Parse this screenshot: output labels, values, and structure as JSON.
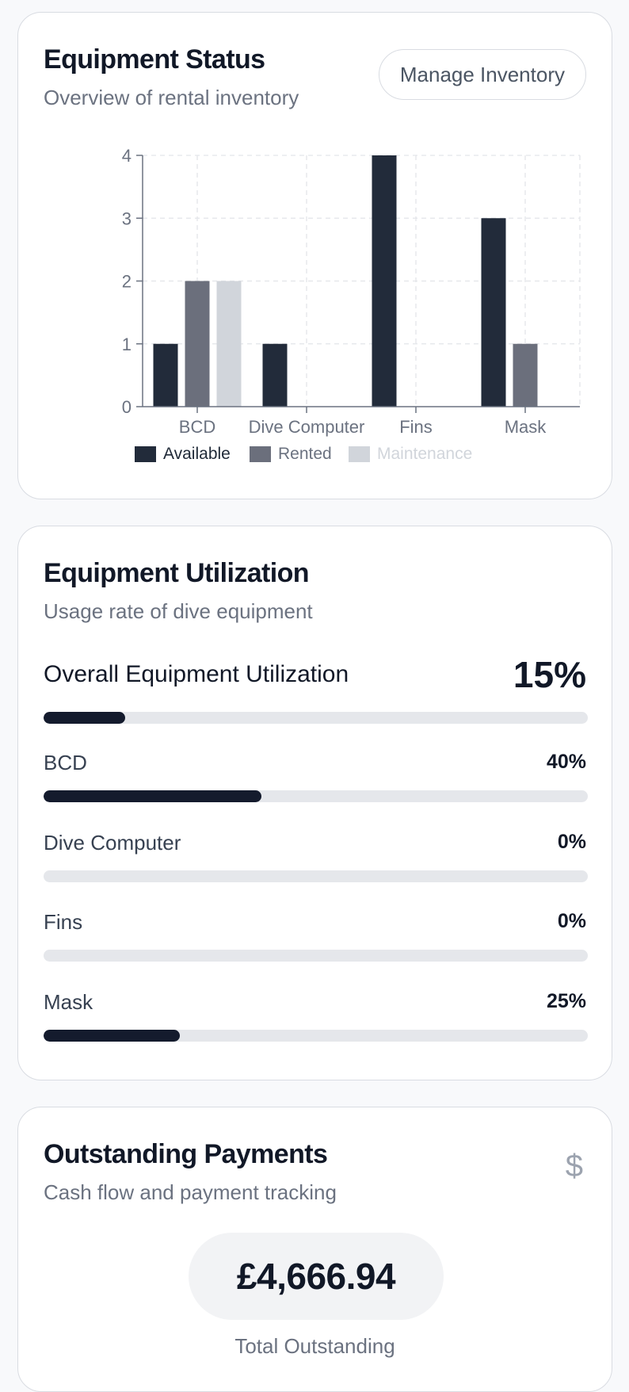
{
  "equipment_status": {
    "title": "Equipment Status",
    "subtitle": "Overview of rental inventory",
    "manage_button": "Manage Inventory"
  },
  "chart_data": {
    "type": "bar",
    "categories": [
      "BCD",
      "Dive Computer",
      "Fins",
      "Mask"
    ],
    "series": [
      {
        "name": "Available",
        "values": [
          1,
          1,
          4,
          3
        ],
        "color": "#222b3a"
      },
      {
        "name": "Rented",
        "values": [
          2,
          0,
          0,
          1
        ],
        "color": "#6b6f7c"
      },
      {
        "name": "Maintenance",
        "values": [
          2,
          0,
          0,
          0
        ],
        "color": "#d1d5db"
      }
    ],
    "yticks": [
      0,
      1,
      2,
      3,
      4
    ],
    "ylim": [
      0,
      4
    ],
    "grid": true,
    "legend": "bottom"
  },
  "utilization": {
    "title": "Equipment Utilization",
    "subtitle": "Usage rate of dive equipment",
    "overall_label": "Overall Equipment Utilization",
    "overall_value": "15%",
    "overall_fraction": 0.15,
    "items": [
      {
        "label": "BCD",
        "value": "40%",
        "fraction": 0.4
      },
      {
        "label": "Dive Computer",
        "value": "0%",
        "fraction": 0.0
      },
      {
        "label": "Fins",
        "value": "0%",
        "fraction": 0.0
      },
      {
        "label": "Mask",
        "value": "25%",
        "fraction": 0.25
      }
    ]
  },
  "payments": {
    "title": "Outstanding Payments",
    "subtitle": "Cash flow and payment tracking",
    "icon": "dollar-icon",
    "icon_glyph": "$",
    "total": "£4,666.94",
    "total_label": "Total Outstanding"
  }
}
